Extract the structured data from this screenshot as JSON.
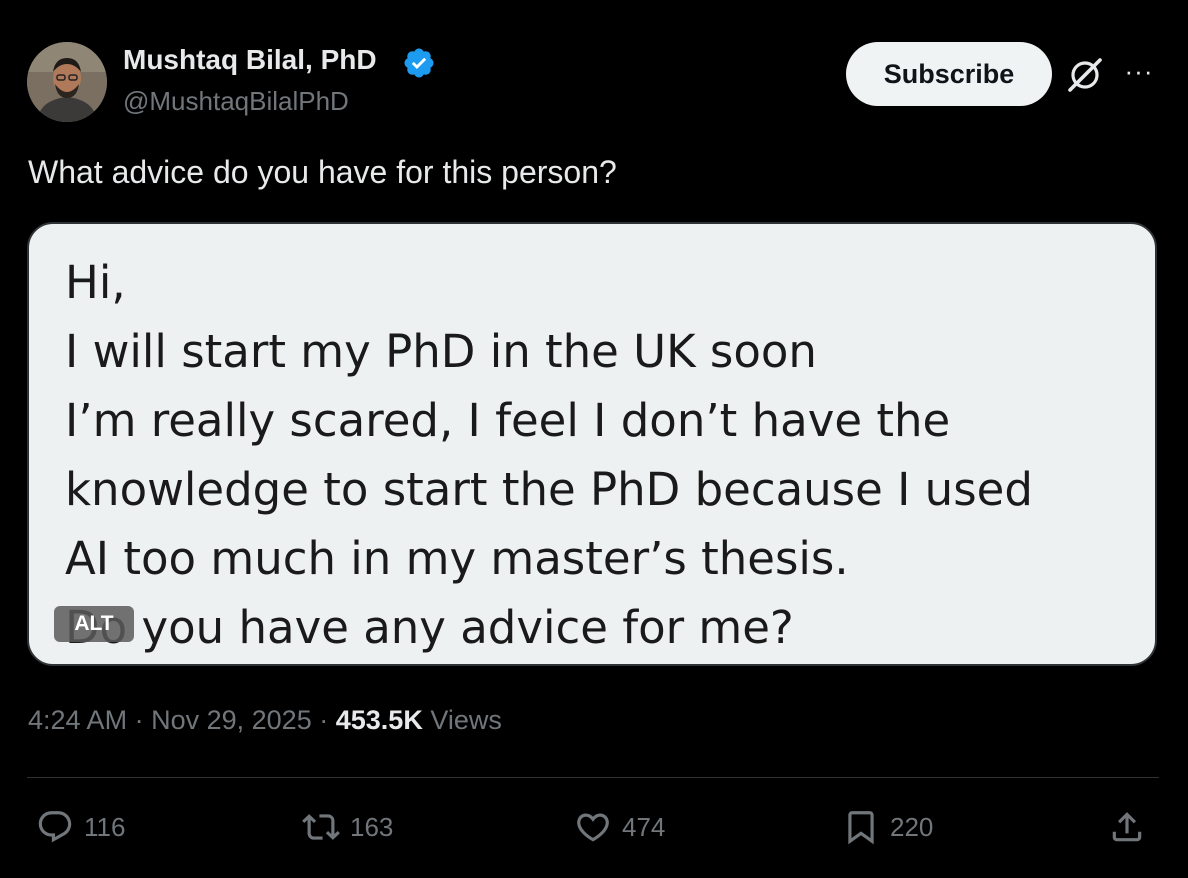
{
  "author": {
    "name": "Mushtaq Bilal, PhD",
    "handle": "@MushtaqBilalPhD",
    "verified": true
  },
  "header": {
    "subscribe_label": "Subscribe",
    "more_label": "···"
  },
  "tweet": {
    "text": "What advice do you have for this person?",
    "media": {
      "lines": [
        "Hi,",
        "I will start my PhD in the UK soon",
        "I’m really scared, I feel I don’t have the",
        "knowledge to start the PhD because I used",
        "AI too much in my master’s thesis.",
        "Do you have any advice for me?"
      ],
      "alt_badge": "ALT"
    },
    "time": "4:24 AM",
    "separator": "·",
    "date": "Nov 29, 2025",
    "views_count": "453.5K",
    "views_label": "Views"
  },
  "actions": {
    "replies": "116",
    "reposts": "163",
    "likes": "474",
    "bookmarks": "220"
  },
  "colors": {
    "background": "#000000",
    "text": "#e7e9ea",
    "muted": "#71767b",
    "verified": "#1d9bf0",
    "media_bg": "#eef1f2"
  }
}
